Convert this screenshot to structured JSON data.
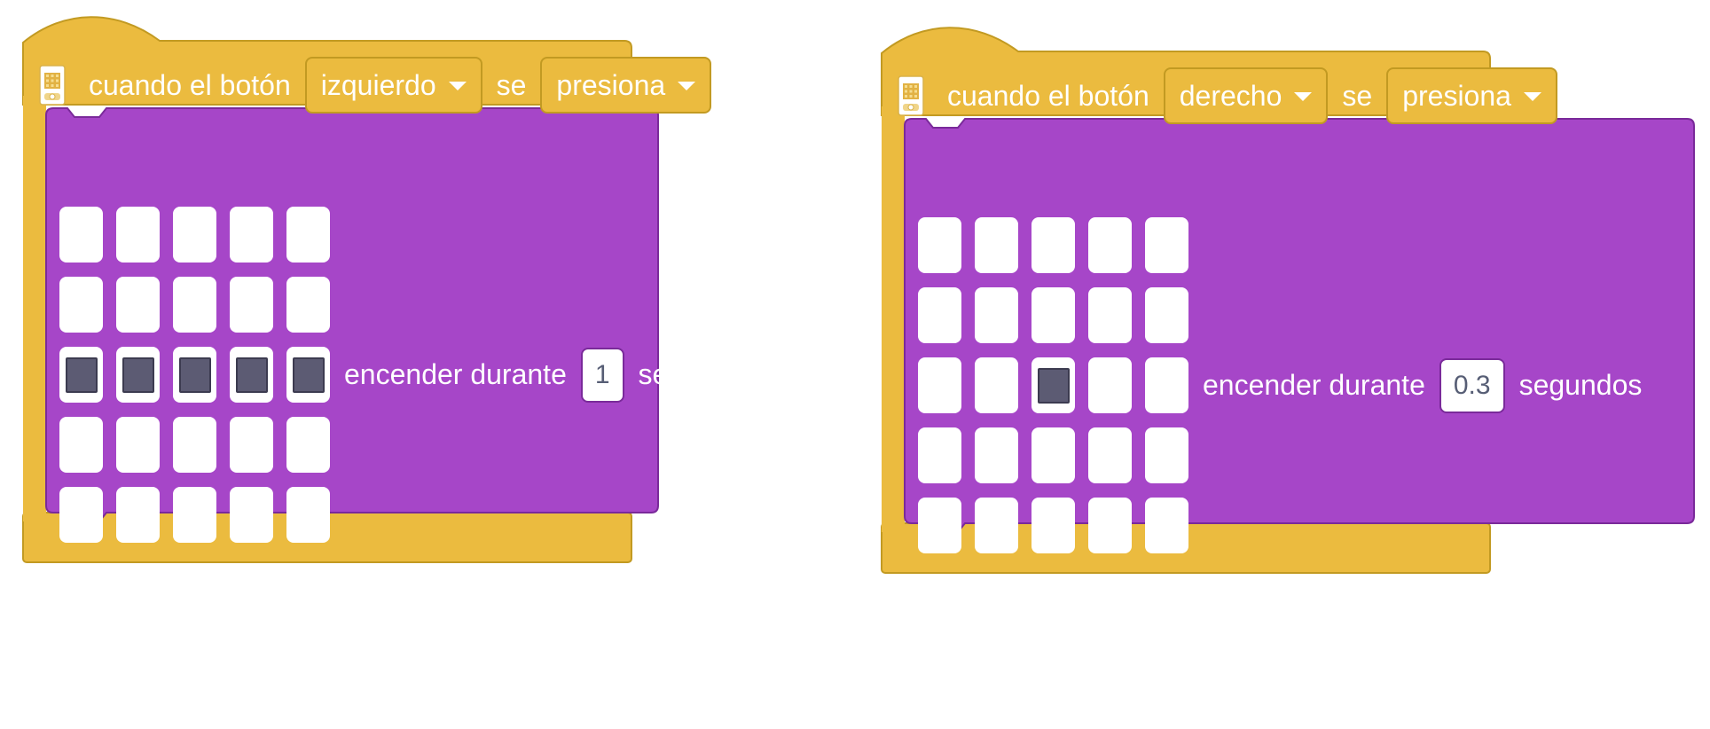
{
  "colors": {
    "event_block": "#ebbb3f",
    "event_border": "#c29a22",
    "looks_block": "#a646c8",
    "looks_border": "#7a2a9a",
    "led_off": "#ffffff",
    "led_on": "#5c5b73"
  },
  "blocks": [
    {
      "icon": "microbit-icon",
      "hat_text_1": "cuando el botón",
      "button_option": "izquierdo",
      "hat_text_2": "se",
      "action_option": "presiona",
      "cmd_text_1": "encender durante",
      "duration": "1",
      "cmd_text_2": "segundos",
      "matrix": [
        [
          0,
          0,
          0,
          0,
          0
        ],
        [
          0,
          0,
          0,
          0,
          0
        ],
        [
          1,
          1,
          1,
          1,
          1
        ],
        [
          0,
          0,
          0,
          0,
          0
        ],
        [
          0,
          0,
          0,
          0,
          0
        ]
      ]
    },
    {
      "icon": "microbit-icon",
      "hat_text_1": "cuando el botón",
      "button_option": "derecho",
      "hat_text_2": "se",
      "action_option": "presiona",
      "cmd_text_1": "encender durante",
      "duration": "0.3",
      "cmd_text_2": "segundos",
      "matrix": [
        [
          0,
          0,
          0,
          0,
          0
        ],
        [
          0,
          0,
          0,
          0,
          0
        ],
        [
          0,
          0,
          1,
          0,
          0
        ],
        [
          0,
          0,
          0,
          0,
          0
        ],
        [
          0,
          0,
          0,
          0,
          0
        ]
      ]
    }
  ]
}
